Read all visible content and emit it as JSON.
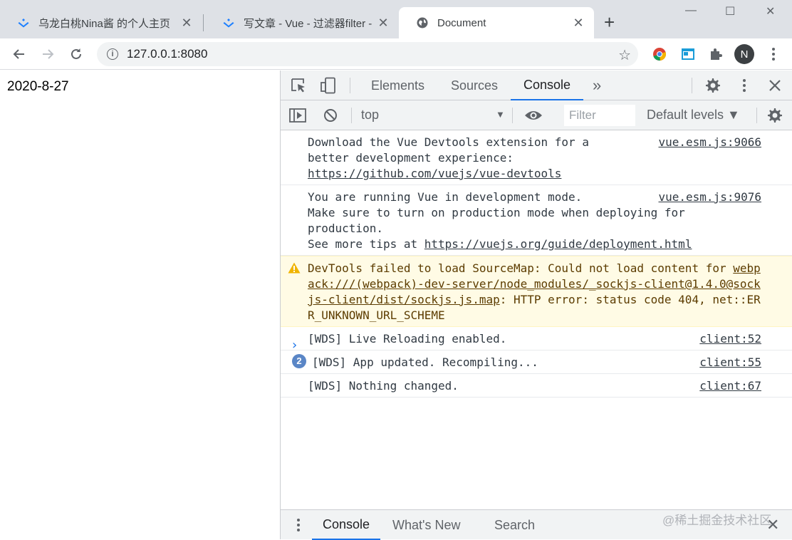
{
  "browser": {
    "tabs": [
      {
        "title": "乌龙白桃Nina酱 的个人主页",
        "close": "✕"
      },
      {
        "title": "写文章 - Vue - 过滤器filter -",
        "close": "✕"
      },
      {
        "title": "Document",
        "close": "✕"
      }
    ],
    "new_tab": "+",
    "window": {
      "minimize": "—",
      "maximize": "☐",
      "close": "✕"
    },
    "address": "127.0.0.1:8080",
    "profile_initial": "N",
    "info_glyph": "i"
  },
  "page": {
    "date_text": "2020-8-27"
  },
  "devtools": {
    "tabs": [
      "Elements",
      "Sources",
      "Console"
    ],
    "more_tabs": "»",
    "context": "top",
    "filter_placeholder": "Filter",
    "levels": "Default levels ▼",
    "messages": [
      {
        "lines": [
          "Download the Vue Devtools extension for a",
          "better development experience:"
        ],
        "link": "https://github.com/vuejs/vue-devtools",
        "source": "vue.esm.js:9066"
      },
      {
        "lines": [
          "You are running Vue in development mode.",
          "Make sure to turn on production mode when deploying for",
          "production."
        ],
        "tip_prefix": "See more tips at ",
        "link": "https://vuejs.org/guide/deployment.html",
        "source": "vue.esm.js:9076"
      },
      {
        "warn_prefix": "DevTools failed to load SourceMap: Could not load content for",
        "link": "webpack:///(webpack)-dev-server/node_modules/_sockjs-client@1.4.0@sockjs-client/dist/sockjs.js.map",
        "warn_suffix": ": HTTP error: status code 404, net::ERR_UNKNOWN_URL_SCHEME"
      },
      {
        "text": "[WDS] Live Reloading enabled.",
        "source": "client:52"
      },
      {
        "text": "[WDS] App updated. Recompiling...",
        "source": "client:55",
        "count": "2"
      },
      {
        "text": "[WDS] Nothing changed.",
        "source": "client:67"
      }
    ],
    "prompt": "›",
    "drawer_tabs": [
      "Console",
      "What's New",
      "Search"
    ],
    "drawer_close": "✕"
  },
  "watermark": "@稀土掘金技术社区",
  "colors": {
    "accent": "#1a73e8",
    "warn_bg": "#fffbe5",
    "tab_strip": "#dee1e6"
  }
}
